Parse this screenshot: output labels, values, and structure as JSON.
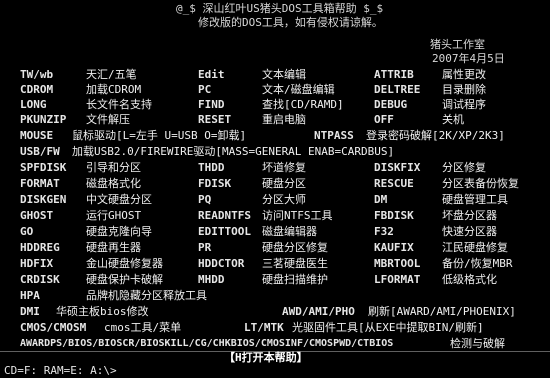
{
  "header": {
    "title_line": "@_$   深山红叶US猪头DOS工具箱帮助  $_$",
    "subtitle": "修改版的DOS工具，如有侵权请谅解。",
    "studio": "猪头工作室",
    "date": "2007年4月5日"
  },
  "rows": [
    [
      {
        "cmd": "TW/wb",
        "desc": "天汇/五笔"
      },
      {
        "cmd": "Edit",
        "desc": "文本编辑"
      },
      {
        "cmd": "ATTRIB",
        "desc": "属性更改"
      }
    ],
    [
      {
        "cmd": "CDROM",
        "desc": "加载CDROM"
      },
      {
        "cmd": "PC",
        "desc": "文本/磁盘编辑"
      },
      {
        "cmd": "DELTREE",
        "desc": "目录删除"
      }
    ],
    [
      {
        "cmd": "LONG",
        "desc": "长文件名支持"
      },
      {
        "cmd": "FIND",
        "desc": "查找[CD/RAMD]"
      },
      {
        "cmd": "DEBUG",
        "desc": "调试程序"
      }
    ],
    [
      {
        "cmd": "PKUNZIP",
        "desc": "文件解压"
      },
      {
        "cmd": "RESET",
        "desc": "重启电脑"
      },
      {
        "cmd": "OFF",
        "desc": "关机"
      }
    ],
    [
      {
        "cmd": "MOUSE",
        "desc": "鼠标驱动[L=左手 U=USB O=卸载]"
      },
      {
        "cmd": "NTPASS",
        "desc": "登录密码破解[2K/XP/2K3]"
      }
    ],
    [
      {
        "cmd": "USB/FW",
        "desc": "加载USB2.0/FIREWIRE驱动[MASS=GENERAL ENAB=CARDBUS]"
      }
    ],
    [
      {
        "cmd": "SPFDISK",
        "desc": "引导和分区"
      },
      {
        "cmd": "THDD",
        "desc": "坏道修复"
      },
      {
        "cmd": "DISKFIX",
        "desc": "分区修复"
      }
    ],
    [
      {
        "cmd": "FORMAT",
        "desc": "磁盘格式化"
      },
      {
        "cmd": "FDISK",
        "desc": "硬盘分区"
      },
      {
        "cmd": "RESCUE",
        "desc": "分区表备份恢复"
      }
    ],
    [
      {
        "cmd": "DISKGEN",
        "desc": "中文硬盘分区"
      },
      {
        "cmd": "PQ",
        "desc": "分区大师"
      },
      {
        "cmd": "DM",
        "desc": "硬盘管理工具"
      }
    ],
    [
      {
        "cmd": "GHOST",
        "desc": "运行GHOST"
      },
      {
        "cmd": "READNTFS",
        "desc": "访问NTFS工具"
      },
      {
        "cmd": "FBDISK",
        "desc": "坏盘分区器"
      }
    ],
    [
      {
        "cmd": "GO",
        "desc": "硬盘克隆向导"
      },
      {
        "cmd": "EDITTOOL",
        "desc": "磁盘编辑器"
      },
      {
        "cmd": "F32",
        "desc": "快速分区器"
      }
    ],
    [
      {
        "cmd": "HDDREG",
        "desc": "硬盘再生器"
      },
      {
        "cmd": "PR",
        "desc": "硬盘分区修复"
      },
      {
        "cmd": "KAUFIX",
        "desc": "江民硬盘修复"
      }
    ],
    [
      {
        "cmd": "HDFIX",
        "desc": "金山硬盘修复器"
      },
      {
        "cmd": "HDDCTOR",
        "desc": "三茗硬盘医生"
      },
      {
        "cmd": "MBRTOOL",
        "desc": "备份/恢复MBR"
      }
    ],
    [
      {
        "cmd": "CRDISK",
        "desc": "硬盘保护卡破解"
      },
      {
        "cmd": "MHDD",
        "desc": "硬盘扫描维护"
      },
      {
        "cmd": "LFORMAT",
        "desc": "低级格式化"
      }
    ],
    [
      {
        "cmd": "HPA",
        "desc": "品牌机隐藏分区释放工具"
      }
    ],
    [
      {
        "cmd": "DMI",
        "desc": "华硕主板bios修改"
      },
      {
        "cmd": "AWD/AMI/PHO",
        "desc": "刷新[AWARD/AMI/PHOENIX]"
      }
    ],
    [
      {
        "cmd": "CMOS/CMOSM",
        "desc": "cmos工具/菜单"
      },
      {
        "cmd": "LT/MTK",
        "desc": "光驱固件工具[从EXE中提取BIN/刷新]"
      }
    ],
    [
      {
        "cmd": "AWARDPS/BIOS/BIOSCR/BIOSKILL/CG/CHKBIOS/CMOSINF/CMOSPWD/CTBIOS",
        "desc": "检测与破解"
      }
    ]
  ],
  "help_line": "【H打开本帮助】",
  "status_line": "CD=F: RAM=E: A:\\>"
}
